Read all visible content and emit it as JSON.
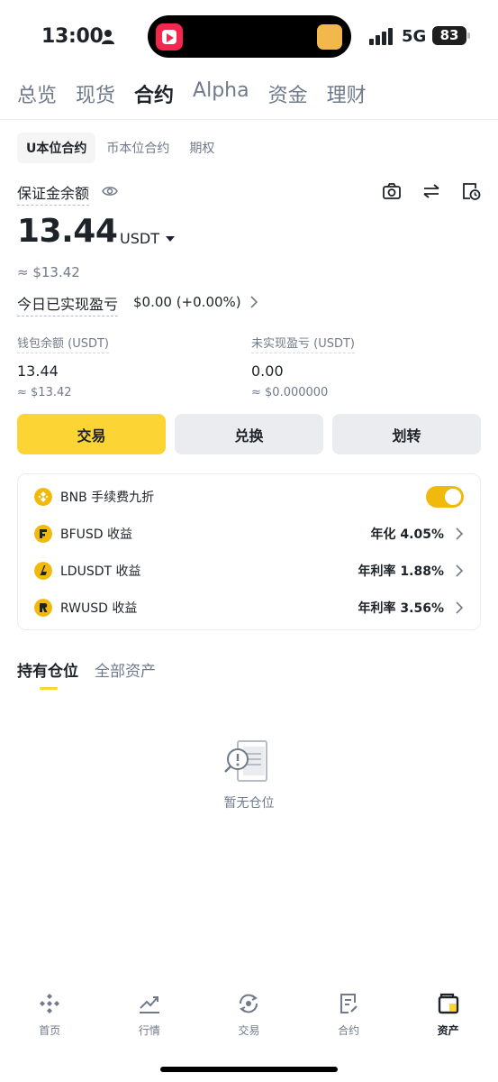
{
  "status_bar": {
    "time": "13:00",
    "network": "5G",
    "battery": "83"
  },
  "main_tabs": [
    {
      "label": "总览",
      "active": false
    },
    {
      "label": "现货",
      "active": false
    },
    {
      "label": "合约",
      "active": true
    },
    {
      "label": "Alpha",
      "active": false
    },
    {
      "label": "资金",
      "active": false
    },
    {
      "label": "理财",
      "active": false
    }
  ],
  "sub_tabs": [
    {
      "label": "U本位合约",
      "active": true
    },
    {
      "label": "币本位合约",
      "active": false
    },
    {
      "label": "期权",
      "active": false
    }
  ],
  "margin": {
    "label": "保证金余额",
    "value": "13.44",
    "currency": "USDT",
    "approx": "≈ $13.42"
  },
  "pnl_today": {
    "label": "今日已实现盈亏",
    "value": "$0.00 (+0.00%)"
  },
  "wallet": {
    "label": "钱包余额 (USDT)",
    "value": "13.44",
    "approx": "≈ $13.42"
  },
  "unrealized": {
    "label": "未实现盈亏 (USDT)",
    "value": "0.00",
    "approx": "≈ $0.000000"
  },
  "actions": {
    "trade": "交易",
    "convert": "兑换",
    "transfer": "划转"
  },
  "card": {
    "bnb_fee": {
      "label": "BNB 手续费九折",
      "enabled": true
    },
    "rows": [
      {
        "label": "BFUSD 收益",
        "value": "年化 4.05%"
      },
      {
        "label": "LDUSDT 收益",
        "value": "年利率 1.88%"
      },
      {
        "label": "RWUSD 收益",
        "value": "年利率 3.56%"
      }
    ]
  },
  "position_tabs": [
    {
      "label": "持有仓位",
      "active": true
    },
    {
      "label": "全部资产",
      "active": false
    }
  ],
  "empty_state": "暂无仓位",
  "bottom_nav": [
    {
      "label": "首页",
      "icon": "home-icon",
      "active": false
    },
    {
      "label": "行情",
      "icon": "markets-icon",
      "active": false
    },
    {
      "label": "交易",
      "icon": "trade-icon",
      "active": false
    },
    {
      "label": "合约",
      "icon": "futures-icon",
      "active": false
    },
    {
      "label": "资产",
      "icon": "wallet-icon",
      "active": true
    }
  ],
  "colors": {
    "accent": "#fcd535",
    "coin": "#f0b90b",
    "text_primary": "#1e2329",
    "text_secondary": "#707a8a"
  }
}
